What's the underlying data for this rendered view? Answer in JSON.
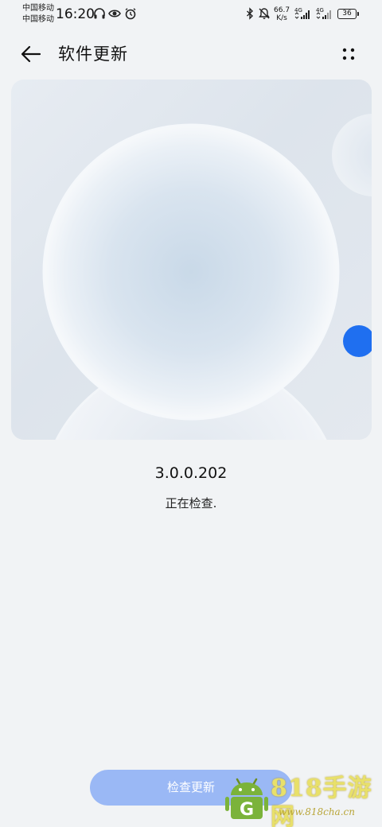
{
  "status_bar": {
    "carrier_1": "中国移动",
    "carrier_2": "中国移动",
    "time": "16:20",
    "net_speed_value": "66.7",
    "net_speed_unit": "K/s",
    "sim1_label": "4G",
    "sim2_label": "4G",
    "battery": "36",
    "icons": [
      "headphones-icon",
      "eye-icon",
      "alarm-icon",
      "bluetooth-icon",
      "mute-icon",
      "signal-icon",
      "battery-icon"
    ]
  },
  "app_bar": {
    "title": "软件更新",
    "back_icon": "arrow-left-icon",
    "more_icon": "more-dots-icon"
  },
  "banner": {
    "accent": "#1f6ff0"
  },
  "version": "3.0.0.202",
  "status_text": "正在检查.",
  "action_button": {
    "label": "检查更新",
    "color": "#9ab8f5"
  },
  "watermark": {
    "title": "818手游网",
    "url": "www.818cha.cn"
  }
}
